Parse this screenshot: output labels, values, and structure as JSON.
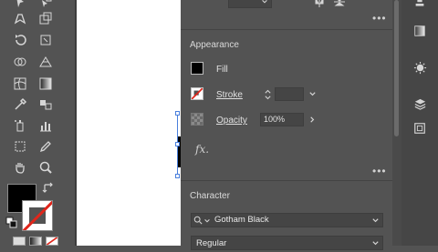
{
  "appearance": {
    "title": "Appearance",
    "fill_label": "Fill",
    "stroke_label": "Stroke",
    "opacity_label": "Opacity",
    "opacity_value": "100%",
    "fx_label": "fx."
  },
  "character": {
    "title": "Character",
    "font_family": "Gotham Black",
    "font_style": "Regular"
  },
  "colors": {
    "panel_bg": "#535353",
    "canvas": "#ffffff",
    "selection": "#4a7fdc",
    "stroke_none_slash": "#e0261b"
  }
}
